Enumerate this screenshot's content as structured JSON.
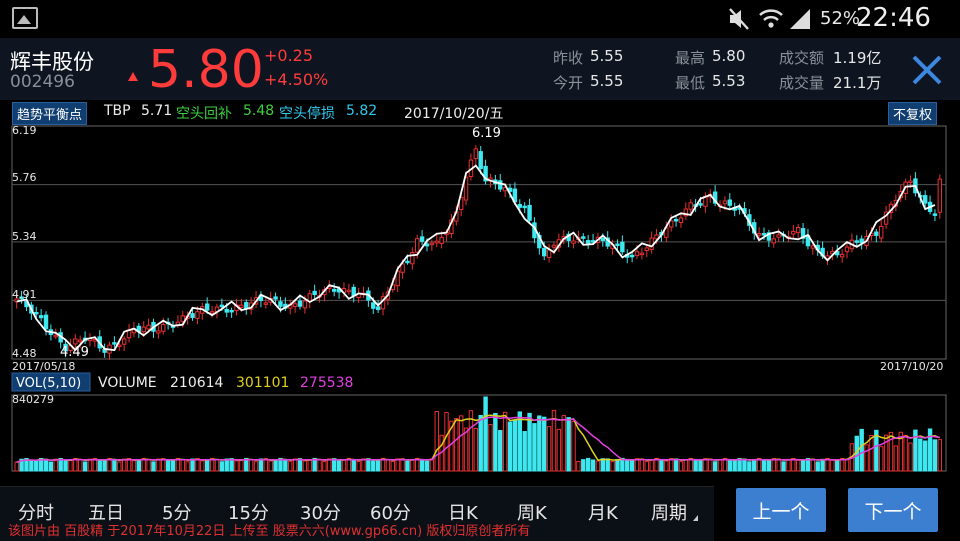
{
  "status_bar": {
    "battery": "52%",
    "time": "22:46"
  },
  "stock": {
    "name": "辉丰股份",
    "code": "002496",
    "price": "5.80",
    "change": "+0.25",
    "change_pct": "+4.50%",
    "prev_close_label": "昨收",
    "prev_close": "5.55",
    "open_label": "今开",
    "open": "5.55",
    "high_label": "最高",
    "high": "5.80",
    "low_label": "最低",
    "low": "5.53",
    "turnover_label": "成交额",
    "turnover": "1.19亿",
    "volume_label": "成交量",
    "volume": "21.1万"
  },
  "indicator": {
    "tag": "趋势平衡点",
    "tbp_label": "TBP",
    "tbp": "5.71",
    "short_cover_label": "空头回补",
    "short_cover": "5.48",
    "short_stop_label": "空头停损",
    "short_stop": "5.82",
    "date": "2017/10/20/五",
    "adjust_button": "不复权"
  },
  "colors": {
    "up": "#e83030",
    "down": "#3ee8f0",
    "ma_line": "#ffffff",
    "vol_ma5": "#e0d020",
    "vol_ma10": "#e040e0",
    "button": "#3c7fd0",
    "price": "#ff3b3b"
  },
  "chart_data": [
    {
      "type": "candlestick",
      "title": "",
      "ylim": [
        4.48,
        6.19
      ],
      "y_ticks": [
        "6.19",
        "5.76",
        "5.34",
        "4.91",
        "4.48"
      ],
      "x_start_label": "2017/05/18",
      "x_end_label": "2017/10/20",
      "high_annotation": "6.19",
      "low_annotation": "4.49",
      "series": [
        {
          "name": "candles"
        },
        {
          "name": "TBP"
        }
      ]
    },
    {
      "type": "bar",
      "title": "VOL(5,10)",
      "volume_label": "VOLUME",
      "volume": "210614",
      "ma5": "301101",
      "ma10": "275538",
      "ymax_label": "840279",
      "ymax": 840279
    }
  ],
  "tabs": [
    "分时",
    "五日",
    "5分",
    "15分",
    "30分",
    "60分",
    "日K",
    "周K",
    "月K",
    "周期"
  ],
  "nav": {
    "prev": "上一个",
    "next": "下一个"
  },
  "watermark": "该图片由 百股精 于2017年10月22日 上传至 股票六六(www.gp66.cn) 版权归原创者所有"
}
